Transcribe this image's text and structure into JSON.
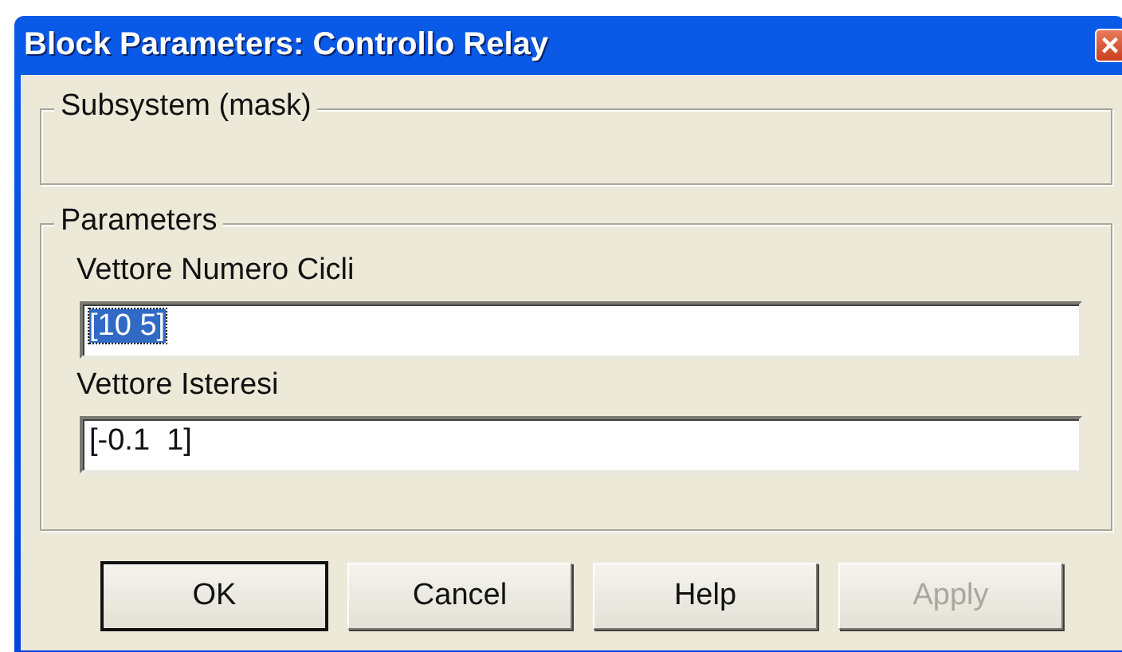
{
  "window": {
    "title": "Block Parameters: Controllo Relay",
    "close": "×"
  },
  "description_group": {
    "title": "Subsystem (mask)"
  },
  "parameters_group": {
    "title": "Parameters",
    "fields": [
      {
        "label": "Vettore Numero Cicli",
        "value": "[10 5]",
        "text_selected": true
      },
      {
        "label": "Vettore Isteresi",
        "value": "[-0.1  1]",
        "text_selected": false
      }
    ]
  },
  "buttons": [
    {
      "label": "OK",
      "default": true,
      "disabled": false
    },
    {
      "label": "Cancel",
      "default": false,
      "disabled": false
    },
    {
      "label": "Help",
      "default": false,
      "disabled": false
    },
    {
      "label": "Apply",
      "default": false,
      "disabled": true
    }
  ]
}
